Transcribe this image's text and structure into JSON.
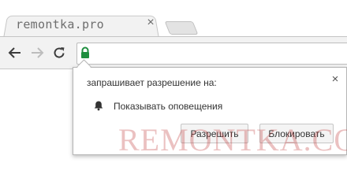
{
  "browser": {
    "tab": {
      "title": "remontka.pro",
      "close_glyph": "×"
    },
    "new_tab_icon": "new-tab-icon",
    "nav": {
      "back_icon": "arrow-left-icon",
      "forward_icon": "arrow-right-icon",
      "reload_icon": "reload-icon"
    },
    "omnibox": {
      "lock_icon": "lock-icon",
      "lock_color": "#1e8e3e",
      "value": ""
    }
  },
  "permission_popup": {
    "title": "запрашивает разрешение на:",
    "close_glyph": "×",
    "permission": {
      "icon": "bell-icon",
      "label": "Показывать оповещения"
    },
    "buttons": {
      "allow": "Разрешить",
      "block": "Блокировать"
    }
  },
  "watermark": {
    "text": "REMONTKA.COM",
    "color": "#be3232"
  }
}
